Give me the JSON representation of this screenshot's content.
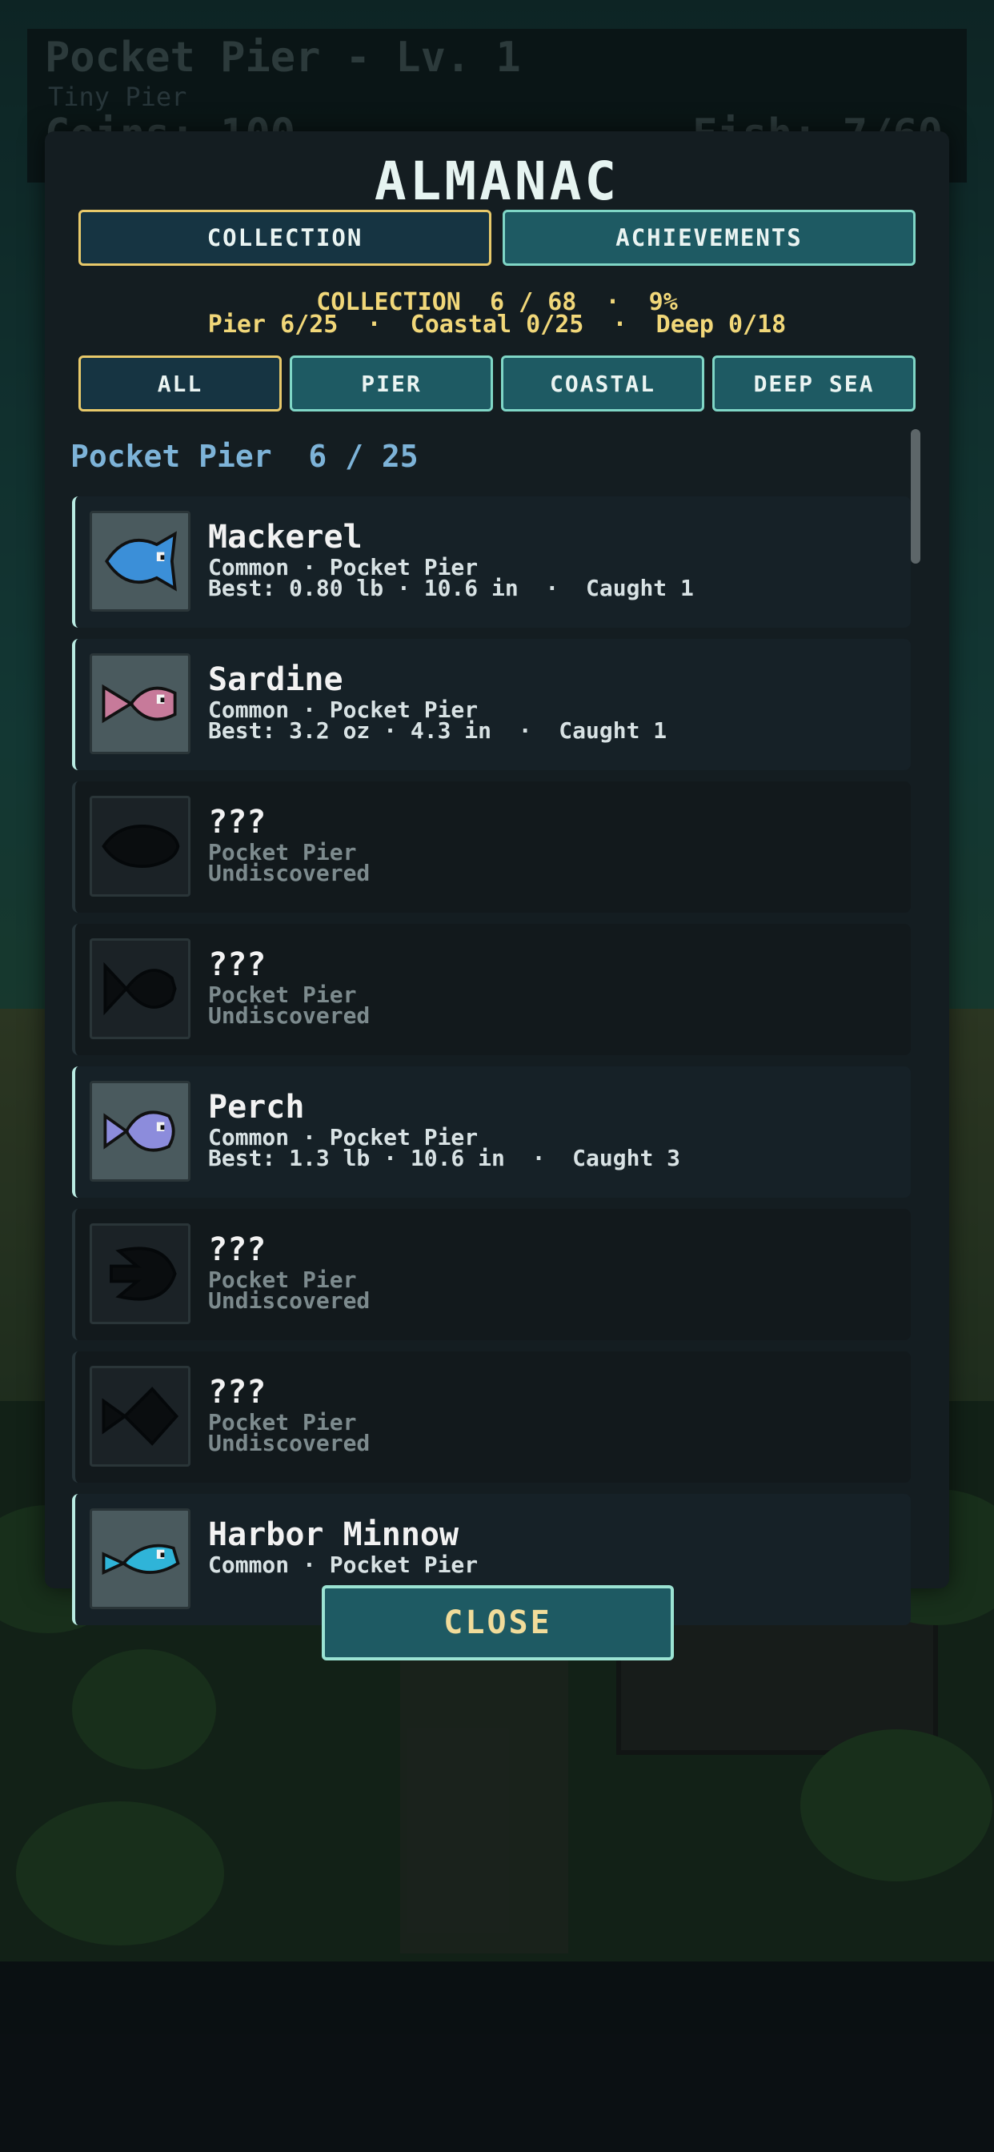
{
  "hud": {
    "title": "Pocket Pier - Lv. 1",
    "subtitle": "Tiny Pier",
    "coins": "Coins: 100",
    "fish": "Fish: 7/60"
  },
  "modal": {
    "title": "ALMANAC",
    "tabs": [
      {
        "label": "COLLECTION",
        "active": true
      },
      {
        "label": "ACHIEVEMENTS",
        "active": false
      }
    ],
    "stats_line1": "COLLECTION  6 / 68  ·  9%",
    "stats_line2": "Pier 6/25  ·  Coastal 0/25  ·  Deep 0/18",
    "filters": [
      {
        "label": "ALL",
        "active": true
      },
      {
        "label": "PIER",
        "active": false
      },
      {
        "label": "COASTAL",
        "active": false
      },
      {
        "label": "DEEP SEA",
        "active": false
      }
    ],
    "section_heading": "Pocket Pier  6 / 25",
    "fish": [
      {
        "name": "Mackerel",
        "line1": "Common · Pocket Pier",
        "line2": "Best: 0.80 lb · 10.6 in  ·  Caught 1",
        "discovered": true,
        "icon": "mackerel-icon",
        "color": "#3b8fd8"
      },
      {
        "name": "Sardine",
        "line1": "Common · Pocket Pier",
        "line2": "Best: 3.2 oz · 4.3 in  ·  Caught 1",
        "discovered": true,
        "icon": "sardine-icon",
        "color": "#c77a9a"
      },
      {
        "name": "???",
        "line1": "Pocket Pier",
        "line2": "Undiscovered",
        "discovered": false,
        "icon": "silhouette-fish-icon",
        "color": "#0a0d0f"
      },
      {
        "name": "???",
        "line1": "Pocket Pier",
        "line2": "Undiscovered",
        "discovered": false,
        "icon": "silhouette-fish-icon",
        "color": "#0a0d0f"
      },
      {
        "name": "Perch",
        "line1": "Common · Pocket Pier",
        "line2": "Best: 1.3 lb · 10.6 in  ·  Caught 3",
        "discovered": true,
        "icon": "perch-icon",
        "color": "#8c8cdc"
      },
      {
        "name": "???",
        "line1": "Pocket Pier",
        "line2": "Undiscovered",
        "discovered": false,
        "icon": "silhouette-fish-icon",
        "color": "#0a0d0f"
      },
      {
        "name": "???",
        "line1": "Pocket Pier",
        "line2": "Undiscovered",
        "discovered": false,
        "icon": "silhouette-fish-icon",
        "color": "#0a0d0f"
      },
      {
        "name": "Harbor Minnow",
        "line1": "Common · Pocket Pier",
        "line2": "",
        "discovered": true,
        "icon": "harbor-minnow-icon",
        "color": "#2fb4d8"
      }
    ],
    "close_label": "CLOSE"
  },
  "colors": {
    "accent_gold": "#e8c96a",
    "accent_teal": "#7fd6c6",
    "heading_blue": "#7db3d8",
    "stats_yellow": "#f1d779"
  }
}
